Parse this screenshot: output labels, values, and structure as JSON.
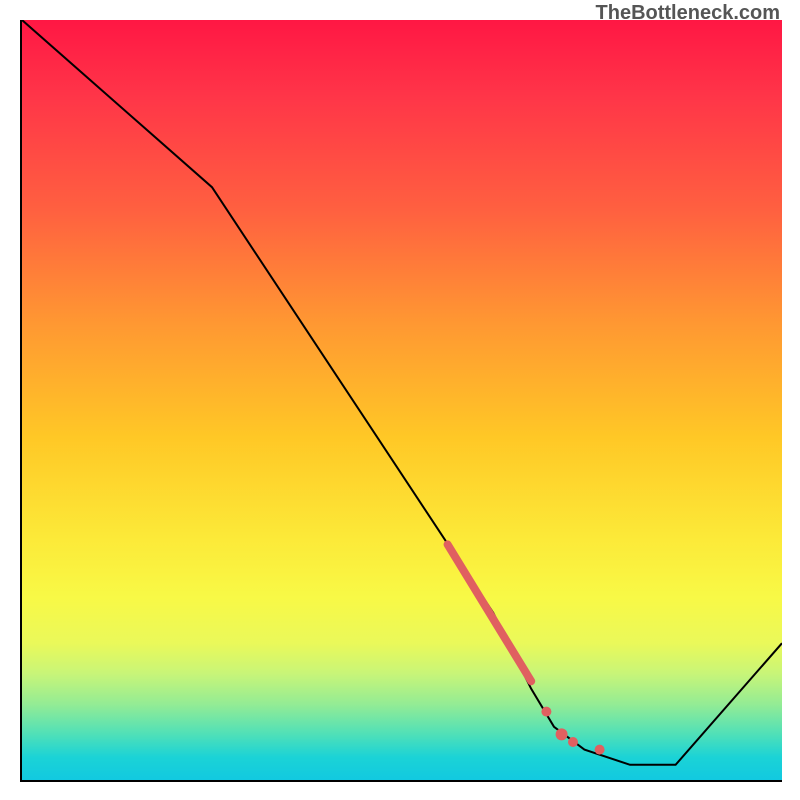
{
  "watermark": "TheBottleneck.com",
  "chart_data": {
    "type": "line",
    "title": "",
    "xlabel": "",
    "ylabel": "",
    "xlim": [
      0,
      100
    ],
    "ylim": [
      0,
      100
    ],
    "line": {
      "x": [
        0,
        25,
        62,
        67,
        70,
        74,
        80,
        86,
        100
      ],
      "y": [
        100,
        78,
        22,
        12,
        7,
        4,
        2,
        2,
        18
      ]
    },
    "highlight_segment": {
      "x": [
        56,
        67
      ],
      "y": [
        31,
        13
      ],
      "color": "#e06060",
      "width": 8
    },
    "markers": [
      {
        "x": 69,
        "y": 9,
        "r": 5,
        "color": "#e06060"
      },
      {
        "x": 71,
        "y": 6,
        "r": 6,
        "color": "#e06060"
      },
      {
        "x": 72.5,
        "y": 5,
        "r": 5,
        "color": "#e06060"
      },
      {
        "x": 76,
        "y": 4,
        "r": 5,
        "color": "#e06060"
      }
    ],
    "background": "rainbow-gradient-red-to-teal"
  }
}
